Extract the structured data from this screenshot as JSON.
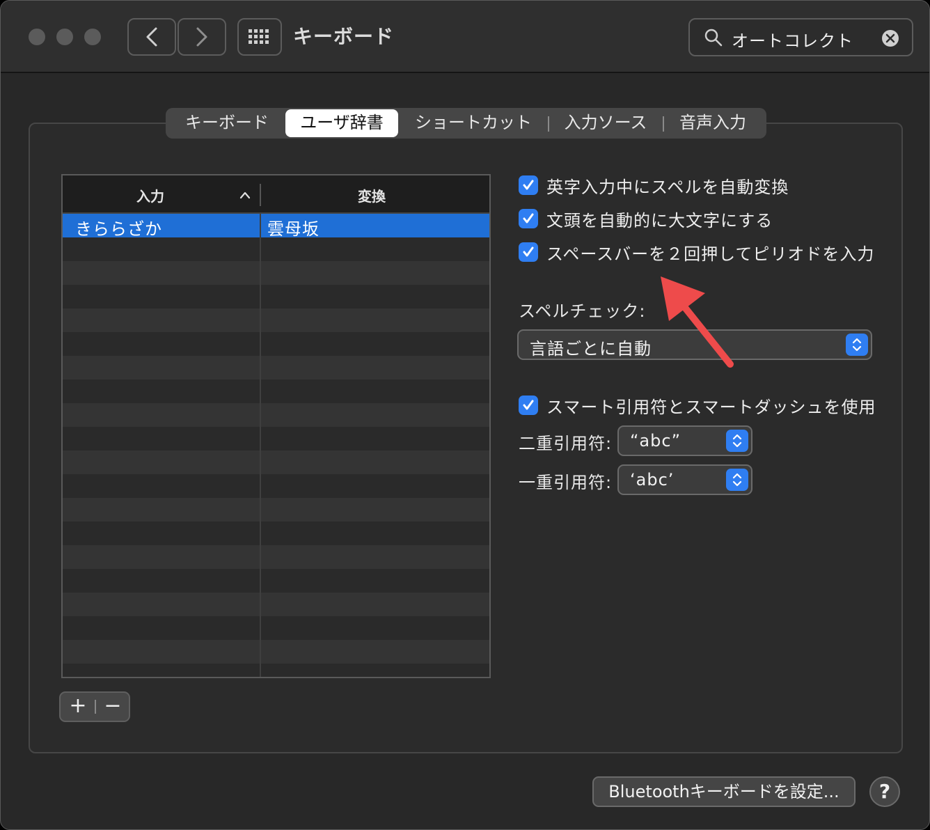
{
  "window": {
    "title": "キーボード"
  },
  "search": {
    "value": "オートコレクト"
  },
  "tabs": [
    {
      "label": "キーボード",
      "active": false
    },
    {
      "label": "ユーザ辞書",
      "active": true
    },
    {
      "label": "ショートカット",
      "active": false
    },
    {
      "label": "入力ソース",
      "active": false
    },
    {
      "label": "音声入力",
      "active": false
    }
  ],
  "table": {
    "columns": [
      "入力",
      "変換"
    ],
    "rows": [
      {
        "input": "きららざか",
        "conversion": "雲母坂",
        "selected": true
      }
    ]
  },
  "table_buttons": {
    "add": "+",
    "remove": "−"
  },
  "options": {
    "autocorrect": {
      "label": "英字入力中にスペルを自動変換",
      "checked": true
    },
    "capitalize": {
      "label": "文頭を自動的に大文字にする",
      "checked": true
    },
    "period": {
      "label": "スペースバーを２回押してピリオドを入力",
      "checked": true
    },
    "spellcheck_label": "スペルチェック:",
    "spellcheck_value": "言語ごとに自動",
    "smart_quotes": {
      "label": "スマート引用符とスマートダッシュを使用",
      "checked": true
    },
    "double_quote_label": "二重引用符:",
    "double_quote_value": "“abc”",
    "single_quote_label": "一重引用符:",
    "single_quote_value": "‘abc’"
  },
  "footer": {
    "bluetooth_button": "Bluetoothキーボードを設定...",
    "help": "?"
  },
  "colors": {
    "accent": "#2f7ef2",
    "selection": "#1f6fd6",
    "annotation_arrow": "#ee4b4b"
  }
}
